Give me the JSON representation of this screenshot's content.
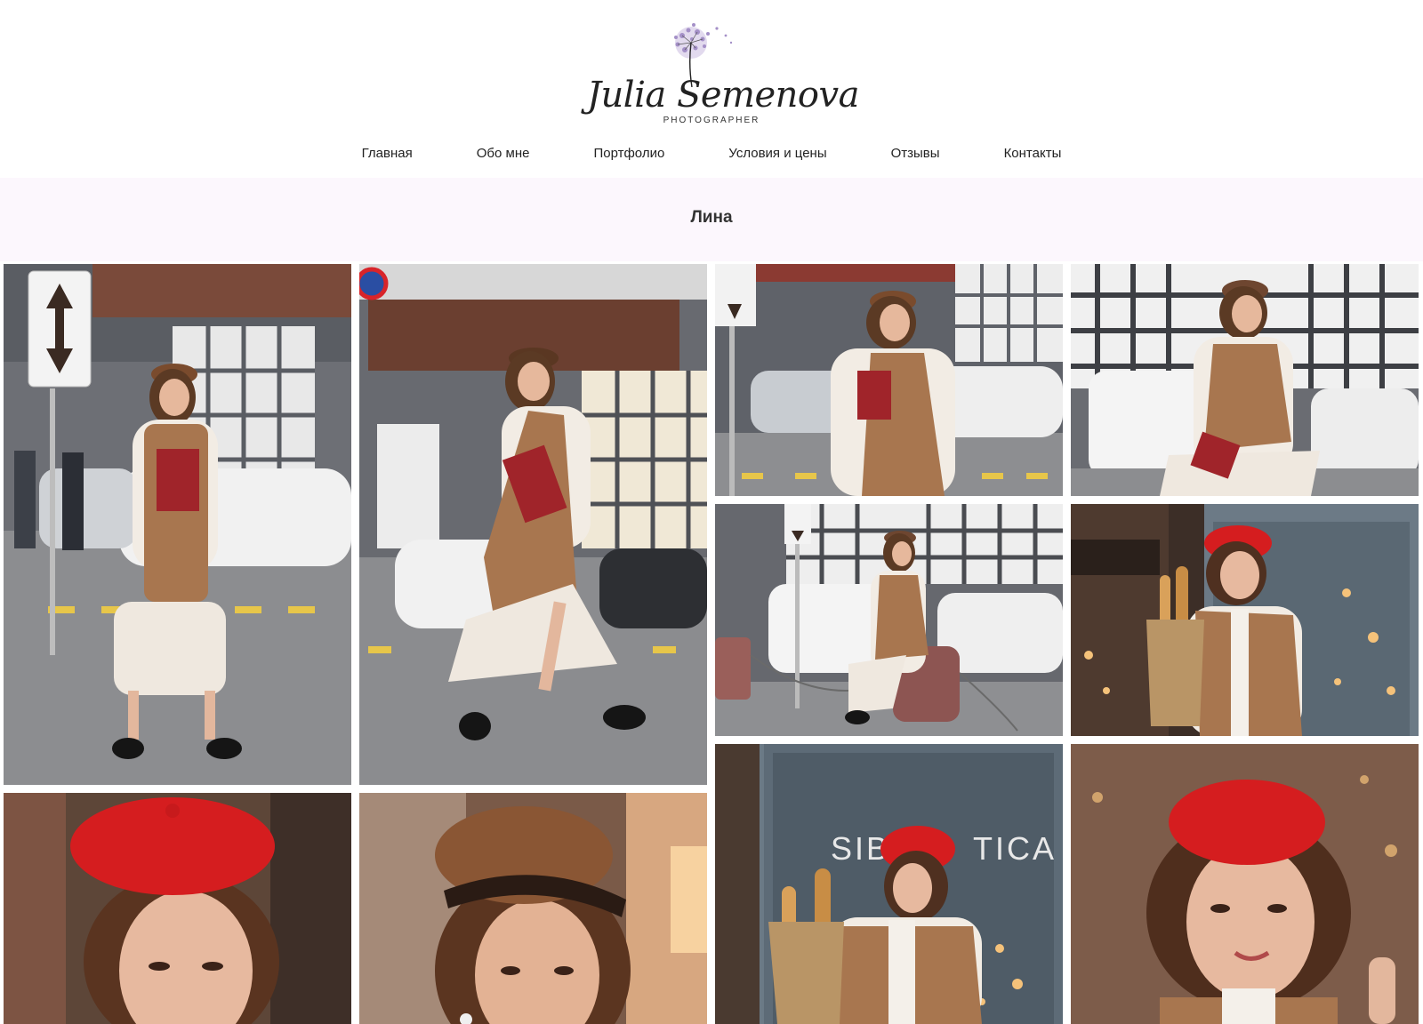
{
  "logo": {
    "name": "Julia Semenova",
    "subtitle": "PHOTOGRAPHER"
  },
  "nav": {
    "items": [
      {
        "label": "Главная"
      },
      {
        "label": "Обо мне"
      },
      {
        "label": "Портфолио"
      },
      {
        "label": "Условия и цены"
      },
      {
        "label": "Отзывы"
      },
      {
        "label": "Контакты"
      }
    ]
  },
  "gallery": {
    "title": "Лина",
    "photos": [
      {
        "name": "photo-walking-road-sign"
      },
      {
        "name": "photo-walking-street"
      },
      {
        "name": "photo-road-sign-cap"
      },
      {
        "name": "photo-sitting-parking"
      },
      {
        "name": "photo-sitting-bollard"
      },
      {
        "name": "photo-baguettes-red-beret"
      },
      {
        "name": "photo-portrait-red-beret"
      },
      {
        "name": "photo-portrait-cap"
      },
      {
        "name": "photo-cafe-storefront"
      },
      {
        "name": "photo-closeup-red-beret"
      }
    ]
  },
  "colors": {
    "title_band": "#fcf7fd",
    "text": "#222222",
    "accent_purple": "#8a6fb0",
    "beret_red": "#d51d1f",
    "vest_brown": "#a0754f"
  }
}
